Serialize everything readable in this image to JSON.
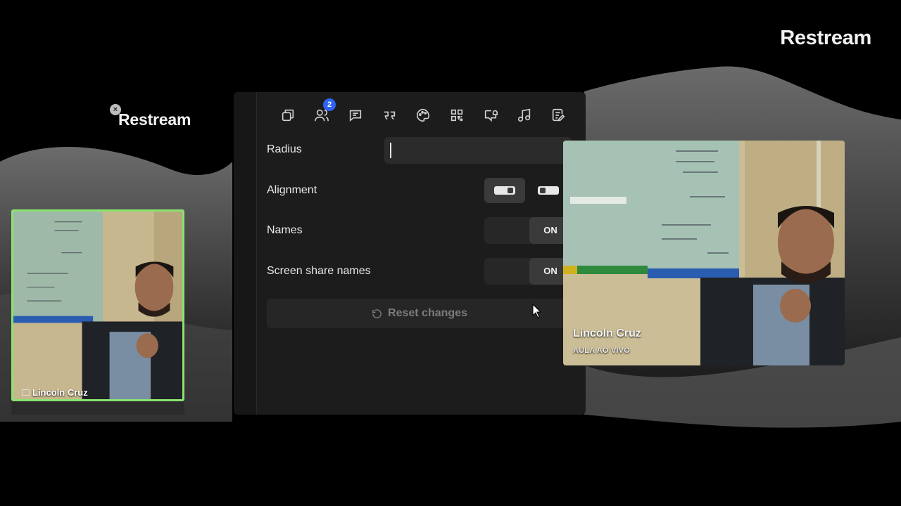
{
  "branding": {
    "top_logo": "Restream",
    "scene_logo": "Restream"
  },
  "toolbar": {
    "icons": [
      "layers-icon",
      "people-icon",
      "comment-icon",
      "quote-icon",
      "palette-icon",
      "qr-code-icon",
      "chat-bell-icon",
      "music-icon",
      "notes-edit-icon"
    ],
    "participants_badge": "2"
  },
  "settings": {
    "radius_label": "Radius",
    "radius_value": "",
    "alignment_label": "Alignment",
    "alignment_selected": "left",
    "names_label": "Names",
    "names_state": "ON",
    "screen_share_names_label": "Screen share names",
    "screen_share_names_state": "ON",
    "reset_label": "Reset changes"
  },
  "cameras": {
    "left_name": "Lincoln Cruz",
    "right_name": "Lincoln Cruz",
    "right_subtitle": "AULA AO VIVO"
  },
  "colors": {
    "active_border": "#8be36e",
    "badge": "#2f62f5",
    "panel_bg": "#1c1c1d"
  }
}
